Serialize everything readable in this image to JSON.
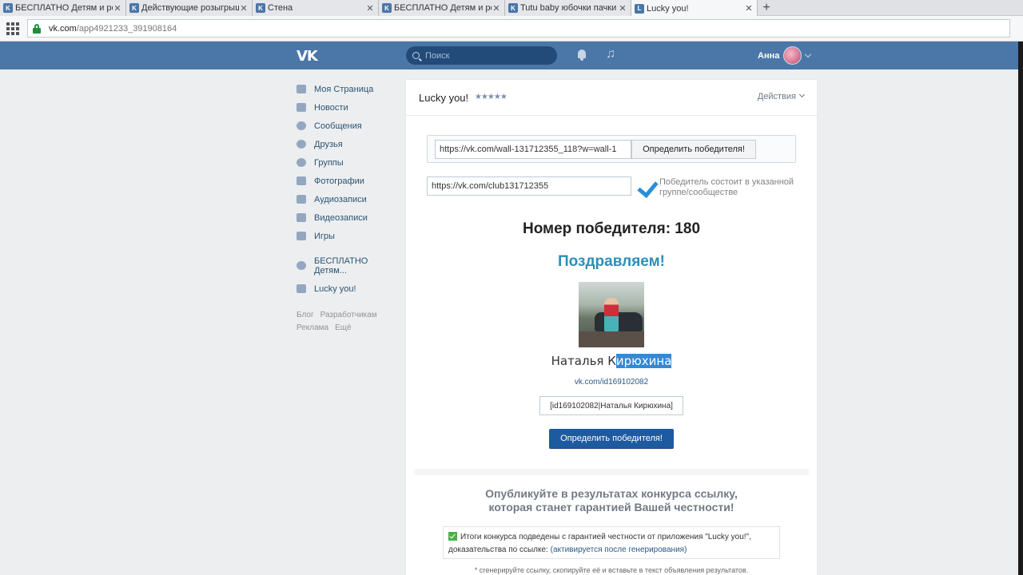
{
  "browser": {
    "tabs": [
      {
        "title": "БЕСПЛАТНО Детям и род",
        "active": false
      },
      {
        "title": "Действующие розыгрыш",
        "active": false
      },
      {
        "title": "Стена",
        "active": false
      },
      {
        "title": "БЕСПЛАТНО Детям и род",
        "active": false
      },
      {
        "title": "Tutu baby юбочки пачки",
        "active": false
      },
      {
        "title": "Lucky you!",
        "active": true
      }
    ],
    "new_tab": "+",
    "url_host": "vk.com",
    "url_path": "/app4921233_391908164"
  },
  "header": {
    "logo": "VK",
    "search_placeholder": "Поиск",
    "user_name": "Анна"
  },
  "menu": {
    "items": [
      {
        "label": "Моя Страница",
        "icon": "home-icon"
      },
      {
        "label": "Новости",
        "icon": "news-icon"
      },
      {
        "label": "Сообщения",
        "icon": "messages-icon"
      },
      {
        "label": "Друзья",
        "icon": "friends-icon"
      },
      {
        "label": "Группы",
        "icon": "groups-icon"
      },
      {
        "label": "Фотографии",
        "icon": "camera-icon"
      },
      {
        "label": "Аудиозаписи",
        "icon": "music-note-icon"
      },
      {
        "label": "Видеозаписи",
        "icon": "video-icon"
      },
      {
        "label": "Игры",
        "icon": "gamepad-icon"
      }
    ],
    "group": "БЕСПЛАТНО Детям...",
    "app": "Lucky you!",
    "footer": [
      "Блог",
      "Разработчикам",
      "Реклама",
      "Ещё"
    ]
  },
  "app": {
    "title": "Lucky you!",
    "rating": "★★★★★",
    "actions": "Действия",
    "post_url": "https://vk.com/wall-131712355_118?w=wall-1",
    "determine_btn": "Определить победителя!",
    "group_url": "https://vk.com/club131712355",
    "check_label": "Победитель состоит в указанной группе/сообществе",
    "winner_number": "Номер победителя: 180",
    "congrats": "Поздравляем!",
    "winner_name_plain": "Наталья К",
    "winner_name_selected": "ирюхина",
    "winner_link": "vk.com/id169102082",
    "winner_code": "[id169102082|Наталья Кирюхина]",
    "determine_btn_main": "Определить победителя!",
    "publish_line1": "Опубликуйте в результатах конкурса ссылку,",
    "publish_line2": "которая станет гарантией Вашей честности!",
    "result_text": "Итоги конкурса подведены с гарантией честности от приложения \"Lucky you!\", доказательства по ссылке:",
    "result_link": "(активируется после генерирования)",
    "hint": "* сгенерируйте ссылку, скопируйте её и вставьте в текст объявления результатов."
  },
  "colors": {
    "vk_blue": "#4a76a8",
    "button_blue": "#1d5aa0",
    "congrats": "#2a8fb8",
    "balloon": "#1f9be0"
  }
}
